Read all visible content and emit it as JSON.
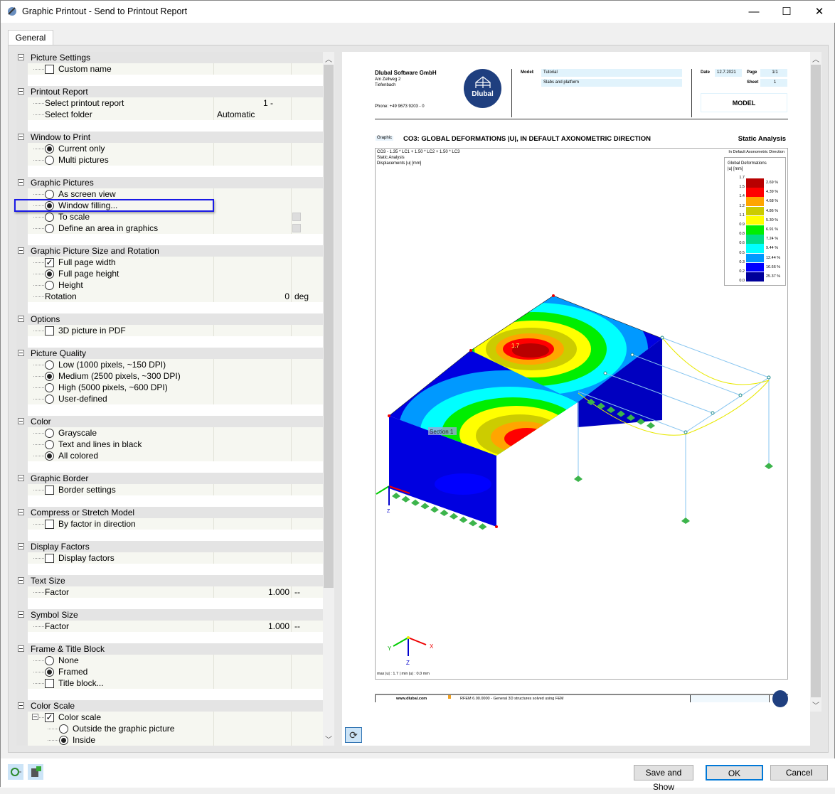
{
  "window": {
    "title": "Graphic Printout - Send to Printout Report",
    "minimize": "—",
    "maximize": "☐",
    "close": "✕"
  },
  "tabs": [
    {
      "label": "General",
      "active": true
    }
  ],
  "tree": [
    {
      "title": "Picture Settings",
      "items": [
        {
          "type": "checkbox",
          "checked": false,
          "label": "Custom name"
        }
      ]
    },
    {
      "title": "Printout Report",
      "items": [
        {
          "type": "text",
          "label": "Select printout report",
          "value": "1 -"
        },
        {
          "type": "text",
          "label": "Select folder",
          "value": "Automatic"
        }
      ]
    },
    {
      "title": "Window to Print",
      "items": [
        {
          "type": "radio",
          "checked": true,
          "label": "Current only"
        },
        {
          "type": "radio",
          "checked": false,
          "label": "Multi pictures"
        }
      ]
    },
    {
      "title": "Graphic Pictures",
      "items": [
        {
          "type": "radio",
          "checked": false,
          "label": "As screen view"
        },
        {
          "type": "radio",
          "checked": true,
          "label": "Window filling...",
          "highlighted": true
        },
        {
          "type": "radio",
          "checked": false,
          "label": "To scale",
          "button": true
        },
        {
          "type": "radio",
          "checked": false,
          "label": "Define an area in graphics",
          "button": true
        }
      ]
    },
    {
      "title": "Graphic Picture Size and Rotation",
      "items": [
        {
          "type": "checkbox",
          "checked": true,
          "label": "Full page width"
        },
        {
          "type": "radio",
          "checked": true,
          "label": "Full page height"
        },
        {
          "type": "radio",
          "checked": false,
          "label": "Height"
        },
        {
          "type": "text",
          "label": "Rotation",
          "value": "0",
          "unit": "deg"
        }
      ]
    },
    {
      "title": "Options",
      "items": [
        {
          "type": "checkbox",
          "checked": false,
          "label": "3D picture in PDF"
        }
      ]
    },
    {
      "title": "Picture Quality",
      "items": [
        {
          "type": "radio",
          "checked": false,
          "label": "Low (1000 pixels, ~150 DPI)"
        },
        {
          "type": "radio",
          "checked": true,
          "label": "Medium (2500 pixels, ~300 DPI)"
        },
        {
          "type": "radio",
          "checked": false,
          "label": "High (5000 pixels, ~600 DPI)"
        },
        {
          "type": "radio",
          "checked": false,
          "label": "User-defined"
        }
      ]
    },
    {
      "title": "Color",
      "items": [
        {
          "type": "radio",
          "checked": false,
          "label": "Grayscale"
        },
        {
          "type": "radio",
          "checked": false,
          "label": "Text and lines in black"
        },
        {
          "type": "radio",
          "checked": true,
          "label": "All colored"
        }
      ]
    },
    {
      "title": "Graphic Border",
      "items": [
        {
          "type": "checkbox",
          "checked": false,
          "label": "Border settings"
        }
      ]
    },
    {
      "title": "Compress or Stretch Model",
      "items": [
        {
          "type": "checkbox",
          "checked": false,
          "label": "By factor in direction"
        }
      ]
    },
    {
      "title": "Display Factors",
      "items": [
        {
          "type": "checkbox",
          "checked": false,
          "label": "Display factors"
        }
      ]
    },
    {
      "title": "Text Size",
      "items": [
        {
          "type": "text",
          "label": "Factor",
          "value": "1.000",
          "unit": "--",
          "align": "right"
        }
      ]
    },
    {
      "title": "Symbol Size",
      "items": [
        {
          "type": "text",
          "label": "Factor",
          "value": "1.000",
          "unit": "--",
          "align": "right"
        }
      ]
    },
    {
      "title": "Frame & Title Block",
      "items": [
        {
          "type": "radio",
          "checked": false,
          "label": "None"
        },
        {
          "type": "radio",
          "checked": true,
          "label": "Framed"
        },
        {
          "type": "checkbox",
          "checked": false,
          "label": "Title block..."
        }
      ]
    },
    {
      "title": "Color Scale",
      "items": [
        {
          "type": "checkbox",
          "checked": true,
          "label": "Color scale",
          "expander": true
        },
        {
          "type": "radio",
          "checked": false,
          "label": "Outside the graphic picture",
          "level": 2
        },
        {
          "type": "radio",
          "checked": true,
          "label": "Inside",
          "level": 2
        }
      ]
    }
  ],
  "preview": {
    "company": "Dlubal Software GmbH",
    "street": "Am Zellweg 2",
    "city": "Tiefenbach",
    "phone": "Phone: +49 9673 9203 - 0",
    "logo": "Dlubal",
    "model_label": "Model:",
    "model_name": "Tutorial",
    "model_desc": "Slabs and platform",
    "date_label": "Date",
    "date": "12.7.2021",
    "page_label": "Page",
    "page": "1/1",
    "sheet_label": "Sheet",
    "sheet": "1",
    "section": "MODEL",
    "graphic_tag": "Graphic",
    "graphic_title": "CO3: GLOBAL DEFORMATIONS |U|, IN DEFAULT AXONOMETRIC DIRECTION",
    "analysis": "Static Analysis",
    "info1": "CO3 - 1.35 * LC1 + 1.50 * LC2 + 1.50 * LC3",
    "info2": "Static Analysis",
    "info3": "Displacements |u| [mm]",
    "direction": "In Default Axonometric Direction",
    "legend_title": "Global Deformations",
    "legend_unit": "|u| [mm]",
    "legend_values": [
      "1.7",
      "1.5",
      "1.4",
      "1.2",
      "1.1",
      "0.9",
      "0.8",
      "0.6",
      "0.5",
      "0.3",
      "0.2",
      "0.0"
    ],
    "legend_percents": [
      "2.69 %",
      "4.39 %",
      "4.68 %",
      "4.86 %",
      "5.30 %",
      "6.91 %",
      "7.24 %",
      "9.44 %",
      "12.44 %",
      "16.66 %",
      "25.37 %"
    ],
    "legend_colors": [
      "#b80000",
      "#ff0000",
      "#ffa500",
      "#cccc00",
      "#ffff00",
      "#00ee00",
      "#00dd88",
      "#00ffff",
      "#0099ff",
      "#0000ff",
      "#00009a"
    ],
    "max_label": "1.7",
    "section_label": "Section 1",
    "axis_x": "X",
    "axis_y": "Y",
    "axis_z": "Z",
    "footer_min_max": "max |u| : 1.7 | min |u| : 0.0 mm",
    "footer_web": "www.dlubal.com",
    "footer_software": "RFEM 6.00.0000 - General 3D structures solved using FEM"
  },
  "buttons": {
    "save_show": "Save and Show",
    "ok": "OK",
    "cancel": "Cancel"
  },
  "icons": {
    "refresh": "⟳"
  }
}
